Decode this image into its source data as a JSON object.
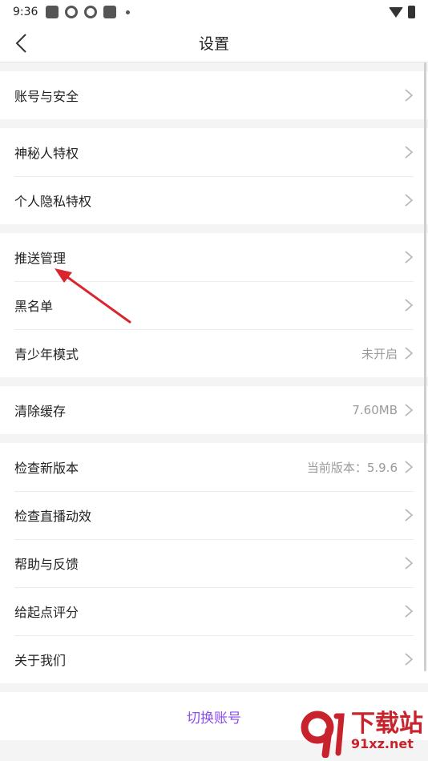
{
  "status": {
    "time": "9:36"
  },
  "header": {
    "title": "设置"
  },
  "groups": [
    {
      "items": [
        {
          "label": "账号与安全"
        }
      ]
    },
    {
      "items": [
        {
          "label": "神秘人特权"
        },
        {
          "label": "个人隐私特权"
        }
      ]
    },
    {
      "items": [
        {
          "label": "推送管理"
        },
        {
          "label": "黑名单"
        },
        {
          "label": "青少年模式",
          "value": "未开启"
        }
      ]
    },
    {
      "items": [
        {
          "label": "清除缓存",
          "value": "7.60MB"
        }
      ]
    },
    {
      "items": [
        {
          "label": "检查新版本",
          "value": "当前版本：5.9.6"
        },
        {
          "label": "检查直播动效"
        },
        {
          "label": "帮助与反馈"
        },
        {
          "label": "给起点评分"
        },
        {
          "label": "关于我们"
        }
      ]
    }
  ],
  "footer": {
    "switch_account": "切换账号"
  },
  "watermark": {
    "brand": "下载站",
    "domain": "91xz.net"
  },
  "colors": {
    "accent": "#8a4ef0",
    "annotation": "#d9262e"
  }
}
